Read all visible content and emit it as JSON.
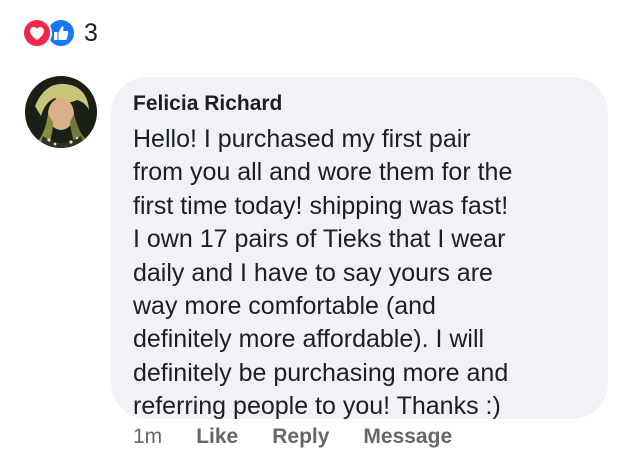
{
  "reactions": {
    "icons": [
      "heart-icon",
      "thumbs-up-icon"
    ],
    "count": "3",
    "colors": {
      "love": "#f0284a",
      "like": "#1877f2"
    }
  },
  "comment": {
    "author": "Felicia Richard",
    "text_lines": [
      "Hello! I purchased my first pair",
      "from you all and wore them for the",
      "first time today!  shipping was fast!",
      "I own 17 pairs of Tieks that I wear",
      "daily and I have to say yours are",
      "way more comfortable (and",
      "definitely more affordable). I will",
      "definitely be purchasing more and",
      "referring people to you! Thanks :)"
    ],
    "bubble_color": "#f0f2f5"
  },
  "actions": {
    "time": "1m",
    "like_label": "Like",
    "reply_label": "Reply",
    "message_label": "Message"
  }
}
